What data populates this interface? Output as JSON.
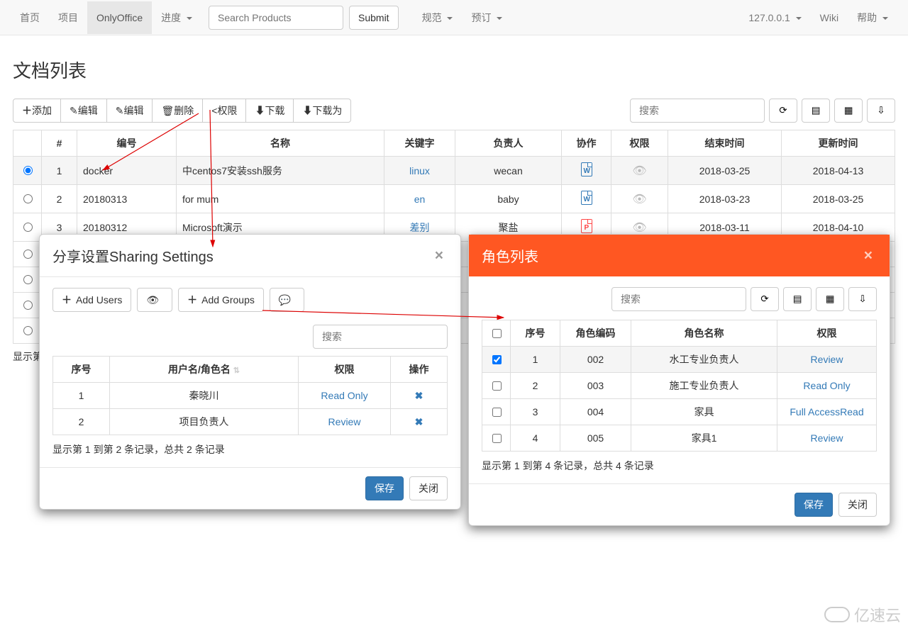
{
  "nav": {
    "left": [
      "首页",
      "项目",
      "OnlyOffice",
      "进度"
    ],
    "active_index": 2,
    "dropdown_flags": [
      false,
      false,
      false,
      true
    ],
    "search_placeholder": "Search Products",
    "submit_label": "Submit",
    "center": [
      "规范",
      "预订"
    ],
    "center_dropdown_flags": [
      true,
      true
    ],
    "right": [
      "127.0.0.1",
      "Wiki",
      "帮助"
    ],
    "right_dropdown_flags": [
      true,
      false,
      true
    ]
  },
  "page": {
    "title": "文档列表",
    "toolbar": [
      "添加",
      "编辑",
      "编辑",
      "删除",
      "权限",
      "下载",
      "下载为"
    ],
    "toolbar_icons": [
      "plus",
      "pencil",
      "pencil",
      "trash",
      "share",
      "download",
      "download"
    ],
    "search_placeholder": "搜索"
  },
  "doc_table": {
    "headers": [
      "",
      "#",
      "编号",
      "名称",
      "关键字",
      "负责人",
      "协作",
      "权限",
      "结束时间",
      "更新时间"
    ],
    "rows": [
      {
        "sel": true,
        "num": "1",
        "code": "docker",
        "name": "中centos7安装ssh服务",
        "kw": "linux",
        "owner": "wecan",
        "file": "w",
        "end": "2018-03-25",
        "upd": "2018-04-13"
      },
      {
        "sel": false,
        "num": "2",
        "code": "20180313",
        "name": "for mum",
        "kw": "en",
        "owner": "baby",
        "file": "w",
        "end": "2018-03-23",
        "upd": "2018-03-25"
      },
      {
        "sel": false,
        "num": "3",
        "code": "20180312",
        "name": "Microsoft演示",
        "kw": "差别",
        "owner": "聚盐",
        "file": "p",
        "end": "2018-03-11",
        "upd": "2018-04-10"
      }
    ],
    "footer_info": "显示第"
  },
  "share_modal": {
    "title": "分享设置Sharing Settings",
    "btn_add_users": "Add Users",
    "btn_add_groups": "Add Groups",
    "search_placeholder": "搜索",
    "headers": [
      "序号",
      "用户名/角色名",
      "权限",
      "操作"
    ],
    "rows": [
      {
        "num": "1",
        "name": "秦晓川",
        "perm": "Read Only"
      },
      {
        "num": "2",
        "name": "项目负责人",
        "perm": "Review"
      }
    ],
    "record_info": "显示第 1 到第 2 条记录，总共 2 条记录",
    "save_label": "保存",
    "close_label": "关闭"
  },
  "role_modal": {
    "title": "角色列表",
    "search_placeholder": "搜索",
    "headers": [
      "",
      "序号",
      "角色编码",
      "角色名称",
      "权限"
    ],
    "rows": [
      {
        "sel": true,
        "num": "1",
        "code": "002",
        "name": "水工专业负责人",
        "perm": "Review"
      },
      {
        "sel": false,
        "num": "2",
        "code": "003",
        "name": "施工专业负责人",
        "perm": "Read Only"
      },
      {
        "sel": false,
        "num": "3",
        "code": "004",
        "name": "家具",
        "perm": "Full AccessRead"
      },
      {
        "sel": false,
        "num": "4",
        "code": "005",
        "name": "家具1",
        "perm": "Review"
      }
    ],
    "record_info": "显示第 1 到第 4 条记录，总共 4 条记录",
    "save_label": "保存",
    "close_label": "关闭"
  },
  "watermark": "亿速云"
}
